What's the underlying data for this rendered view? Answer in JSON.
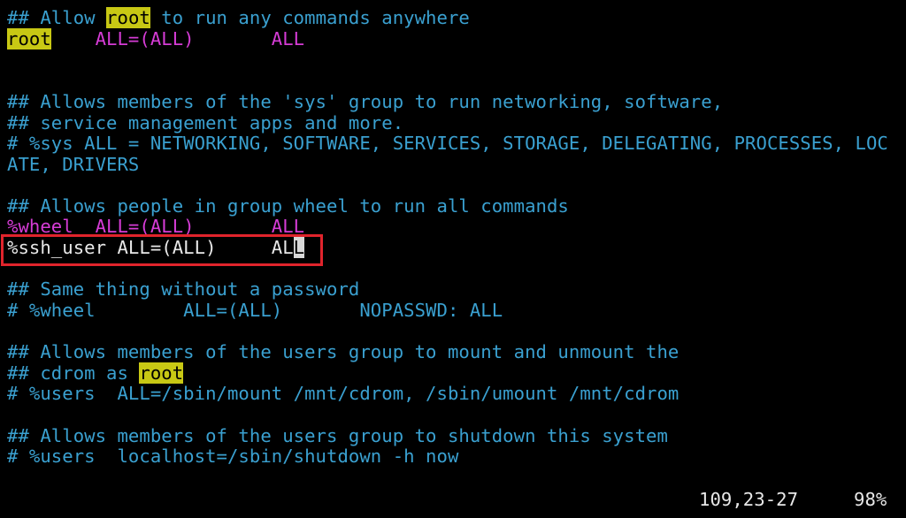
{
  "editor": {
    "lines": {
      "l1a": "## Allow ",
      "l1b": "root",
      "l1c": " to run any commands anywhere",
      "l2a": "root",
      "l2b": "    ALL=(ALL)       ALL",
      "l5": "## Allows members of the 'sys' group to run networking, software,",
      "l6": "## service management apps and more.",
      "l7": "# %sys ALL = NETWORKING, SOFTWARE, SERVICES, STORAGE, DELEGATING, PROCESSES, LOC",
      "l8": "ATE, DRIVERS",
      "l10": "## Allows people in group wheel to run all commands",
      "l11": "%wheel  ALL=(ALL)       ALL",
      "l12a": "%ssh_user ALL=(ALL)     AL",
      "l12b": "L",
      "l14": "## Same thing without a password",
      "l15": "# %wheel        ALL=(ALL)       NOPASSWD: ALL",
      "l17": "## Allows members of the users group to mount and unmount the",
      "l18a": "## cdrom as ",
      "l18b": "root",
      "l19": "# %users  ALL=/sbin/mount /mnt/cdrom, /sbin/umount /mnt/cdrom",
      "l21": "## Allows members of the users group to shutdown this system",
      "l22": "# %users  localhost=/sbin/shutdown -h now"
    },
    "status": {
      "position": "109,23-27",
      "percent": "98%"
    }
  },
  "colors": {
    "background": "#000000",
    "comment": "#3aa0d0",
    "keyword": "#d63cd6",
    "search_highlight": "#c8c814",
    "highlight_box": "#e0242c"
  }
}
